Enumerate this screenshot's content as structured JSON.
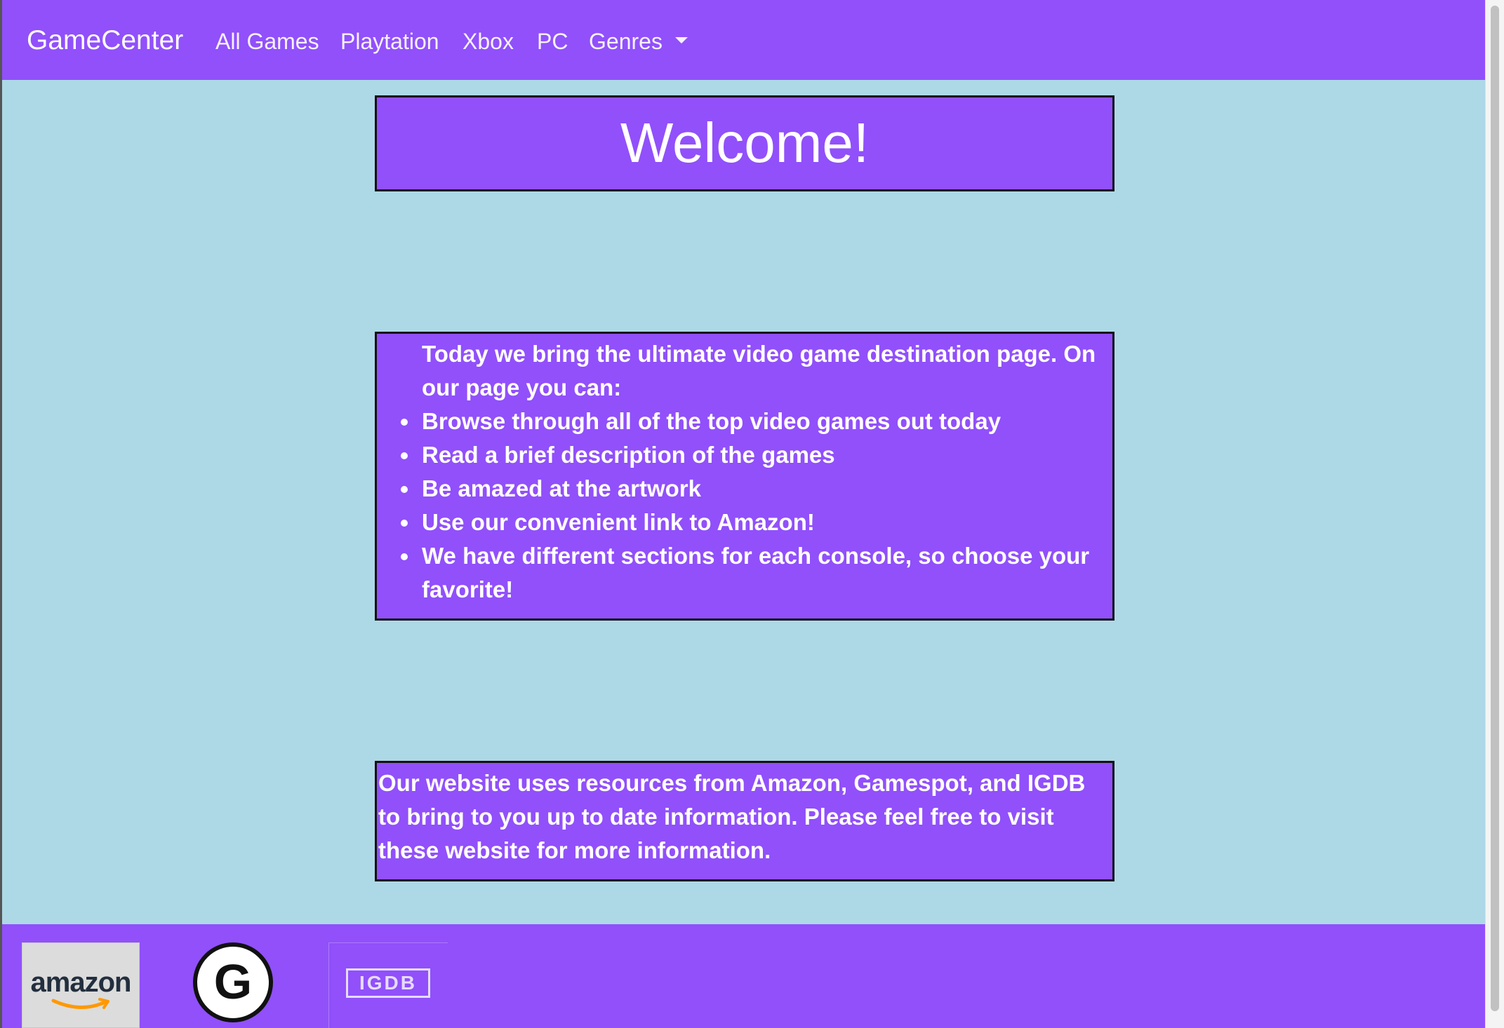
{
  "navbar": {
    "brand": "GameCenter",
    "items": [
      {
        "label": "All Games"
      },
      {
        "label": "Playtation"
      },
      {
        "label": "Xbox"
      },
      {
        "label": "PC"
      },
      {
        "label": "Genres"
      }
    ]
  },
  "welcome": {
    "title": "Welcome!"
  },
  "features": {
    "intro": "Today we bring the ultimate video game destination page. On our page you can:",
    "items": [
      "Browse through all of the top video games out today",
      "Read a brief description of the games",
      "Be amazed at the artwork",
      "Use our convenient link to Amazon!",
      "We have different sections for each console, so choose your favorite!"
    ]
  },
  "resources": {
    "text": "Our website uses resources from Amazon, Gamespot, and IGDB to bring to you up to date information. Please feel free to visit these website for more information."
  },
  "footer": {
    "logos": [
      {
        "name": "amazon",
        "text": "amazon",
        "icon": "amazon-logo"
      },
      {
        "name": "gamespot",
        "text": "G",
        "icon": "gamespot-logo"
      },
      {
        "name": "igdb",
        "text": "IGDB",
        "icon": "igdb-logo"
      }
    ]
  },
  "colors": {
    "primary": "#9150fa",
    "background": "#add8e6",
    "border": "#111111"
  }
}
